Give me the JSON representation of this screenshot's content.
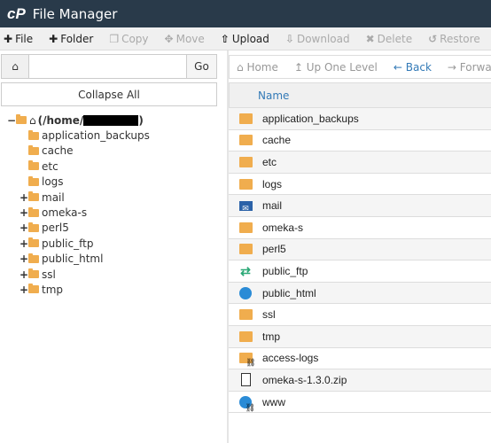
{
  "app": {
    "logo": "cP",
    "title": "File Manager"
  },
  "toolbar": [
    {
      "label": "File",
      "icon": "plus-icon",
      "enabled": true
    },
    {
      "label": "Folder",
      "icon": "plus-icon",
      "enabled": true
    },
    {
      "label": "Copy",
      "icon": "copy-icon",
      "enabled": false
    },
    {
      "label": "Move",
      "icon": "move-icon",
      "enabled": false
    },
    {
      "label": "Upload",
      "icon": "upload-icon",
      "enabled": true
    },
    {
      "label": "Download",
      "icon": "download-icon",
      "enabled": false
    },
    {
      "label": "Delete",
      "icon": "delete-icon",
      "enabled": false
    },
    {
      "label": "Restore",
      "icon": "restore-icon",
      "enabled": false
    }
  ],
  "path": {
    "value": "",
    "go": "Go"
  },
  "collapse_all": "Collapse All",
  "tree": {
    "root": "(/home/",
    "root_end": ")",
    "items": [
      {
        "label": "application_backups",
        "expandable": false
      },
      {
        "label": "cache",
        "expandable": false
      },
      {
        "label": "etc",
        "expandable": false
      },
      {
        "label": "logs",
        "expandable": false
      },
      {
        "label": "mail",
        "expandable": true
      },
      {
        "label": "omeka-s",
        "expandable": true
      },
      {
        "label": "perl5",
        "expandable": true
      },
      {
        "label": "public_ftp",
        "expandable": true
      },
      {
        "label": "public_html",
        "expandable": true
      },
      {
        "label": "ssl",
        "expandable": true
      },
      {
        "label": "tmp",
        "expandable": true
      }
    ]
  },
  "nav": {
    "home": "Home",
    "up": "Up One Level",
    "back": "Back",
    "forward": "Forward"
  },
  "table": {
    "header": "Name",
    "rows": [
      {
        "name": "application_backups",
        "icon": "folder"
      },
      {
        "name": "cache",
        "icon": "folder"
      },
      {
        "name": "etc",
        "icon": "folder"
      },
      {
        "name": "logs",
        "icon": "folder"
      },
      {
        "name": "mail",
        "icon": "mail"
      },
      {
        "name": "omeka-s",
        "icon": "folder"
      },
      {
        "name": "perl5",
        "icon": "folder"
      },
      {
        "name": "public_ftp",
        "icon": "ftp"
      },
      {
        "name": "public_html",
        "icon": "globe"
      },
      {
        "name": "ssl",
        "icon": "folder"
      },
      {
        "name": "tmp",
        "icon": "folder"
      },
      {
        "name": "access-logs",
        "icon": "folder-link"
      },
      {
        "name": "omeka-s-1.3.0.zip",
        "icon": "zip"
      },
      {
        "name": "www",
        "icon": "globe-link"
      }
    ]
  },
  "colors": {
    "header_bg": "#293a4a",
    "folder": "#f0ad4e",
    "link": "#337ab7"
  }
}
